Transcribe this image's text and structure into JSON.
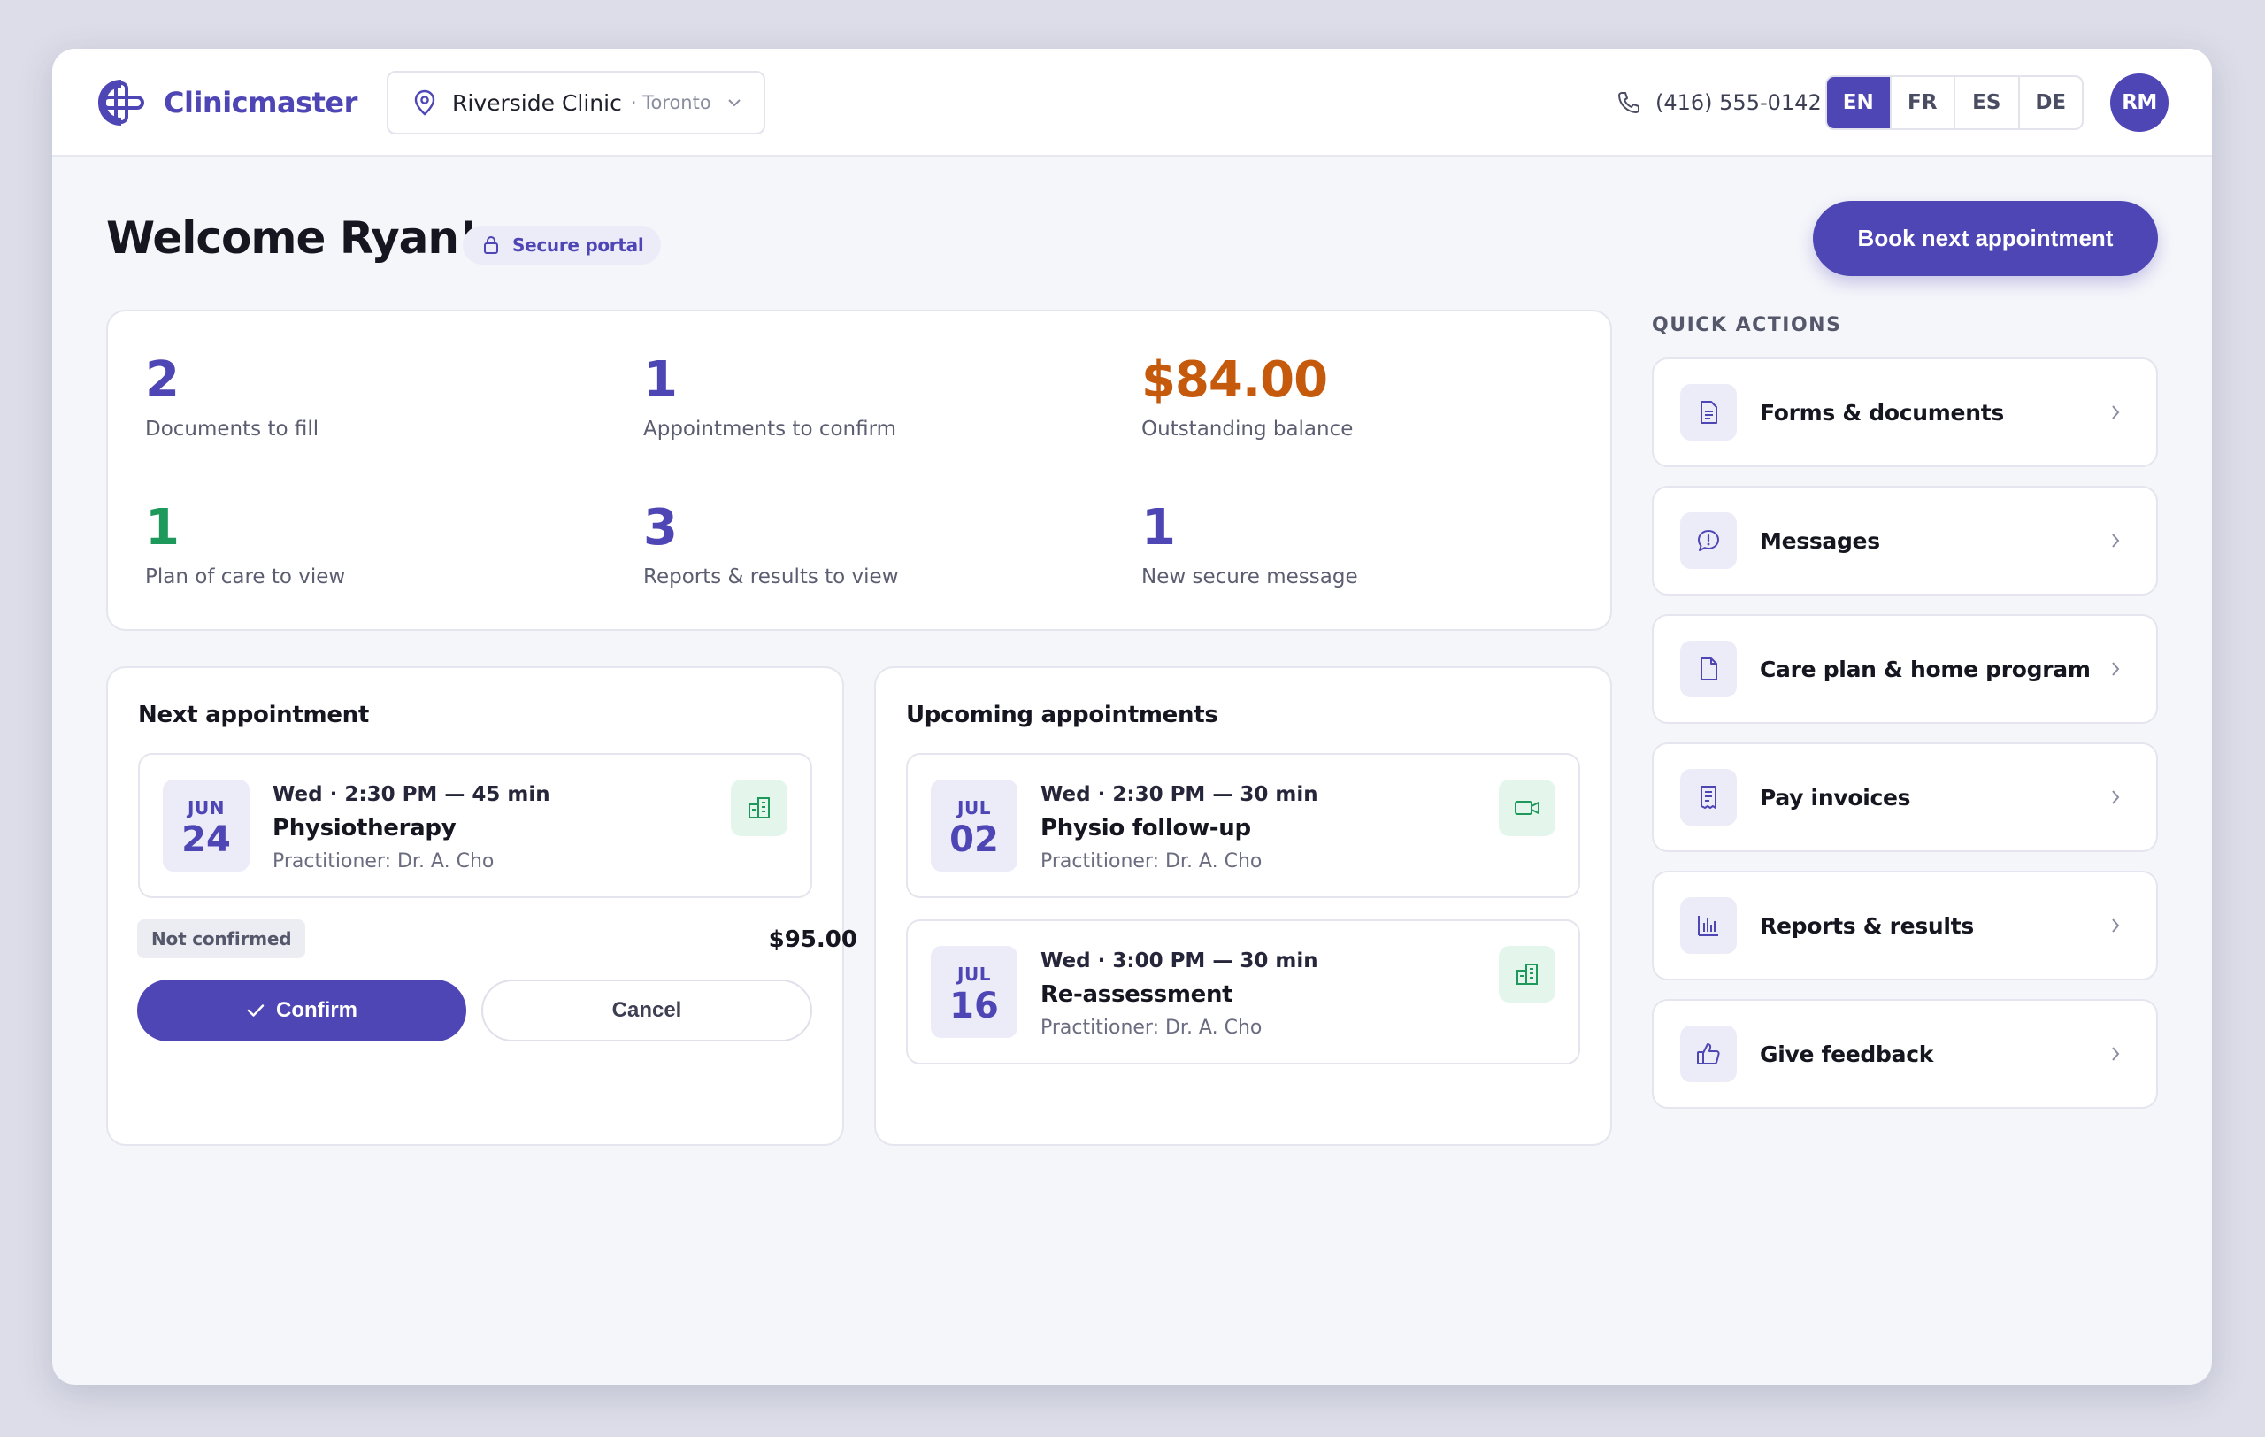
{
  "brand": {
    "name": "Clinicmaster"
  },
  "clinic": {
    "name": "Riverside Clinic",
    "city": "· Toronto"
  },
  "phone": "(416) 555-0142",
  "languages": [
    {
      "code": "EN",
      "active": true
    },
    {
      "code": "FR",
      "active": false
    },
    {
      "code": "ES",
      "active": false
    },
    {
      "code": "DE",
      "active": false
    }
  ],
  "user": {
    "initials": "RM"
  },
  "welcome": "Welcome Ryan!",
  "secure_badge": "Secure portal",
  "book_button": "Book next appointment",
  "stats": [
    {
      "value": "2",
      "label": "Documents to fill",
      "tone": "accent"
    },
    {
      "value": "1",
      "label": "Appointments to confirm",
      "tone": "accent"
    },
    {
      "value": "$84.00",
      "label": "Outstanding balance",
      "tone": "warn"
    },
    {
      "value": "1",
      "label": "Plan of care to view",
      "tone": "good"
    },
    {
      "value": "3",
      "label": "Reports & results to view",
      "tone": "accent"
    },
    {
      "value": "1",
      "label": "New secure message",
      "tone": "accent"
    }
  ],
  "next_appointment": {
    "title": "Next appointment",
    "month": "JUN",
    "day": "24",
    "when": "Wed · 2:30 PM — 45 min",
    "type": "Physiotherapy",
    "practitioner": "Practitioner: Dr. A. Cho",
    "mode_icon": "building-icon",
    "status": "Not confirmed",
    "price": "$95.00",
    "confirm_label": "Confirm",
    "cancel_label": "Cancel"
  },
  "upcoming": {
    "title": "Upcoming appointments",
    "items": [
      {
        "month": "JUL",
        "day": "02",
        "when": "Wed · 2:30 PM — 30 min",
        "type": "Physio follow-up",
        "practitioner": "Practitioner: Dr. A. Cho",
        "mode_icon": "video-icon"
      },
      {
        "month": "JUL",
        "day": "16",
        "when": "Wed · 3:00 PM — 30 min",
        "type": "Re-assessment",
        "practitioner": "Practitioner: Dr. A. Cho",
        "mode_icon": "building-icon"
      }
    ]
  },
  "quick_actions": {
    "heading": "QUICK ACTIONS",
    "items": [
      {
        "label": "Forms & documents",
        "icon": "document-icon"
      },
      {
        "label": "Messages",
        "icon": "message-icon"
      },
      {
        "label": "Care plan & home program",
        "icon": "file-icon"
      },
      {
        "label": "Pay invoices",
        "icon": "invoice-icon"
      },
      {
        "label": "Reports & results",
        "icon": "chart-icon"
      },
      {
        "label": "Give feedback",
        "icon": "thumbs-up-icon"
      }
    ]
  },
  "colors": {
    "accent": "#4f46b6",
    "warn": "#c55a0c",
    "good": "#1d9a5b",
    "background": "#f5f6fa"
  }
}
